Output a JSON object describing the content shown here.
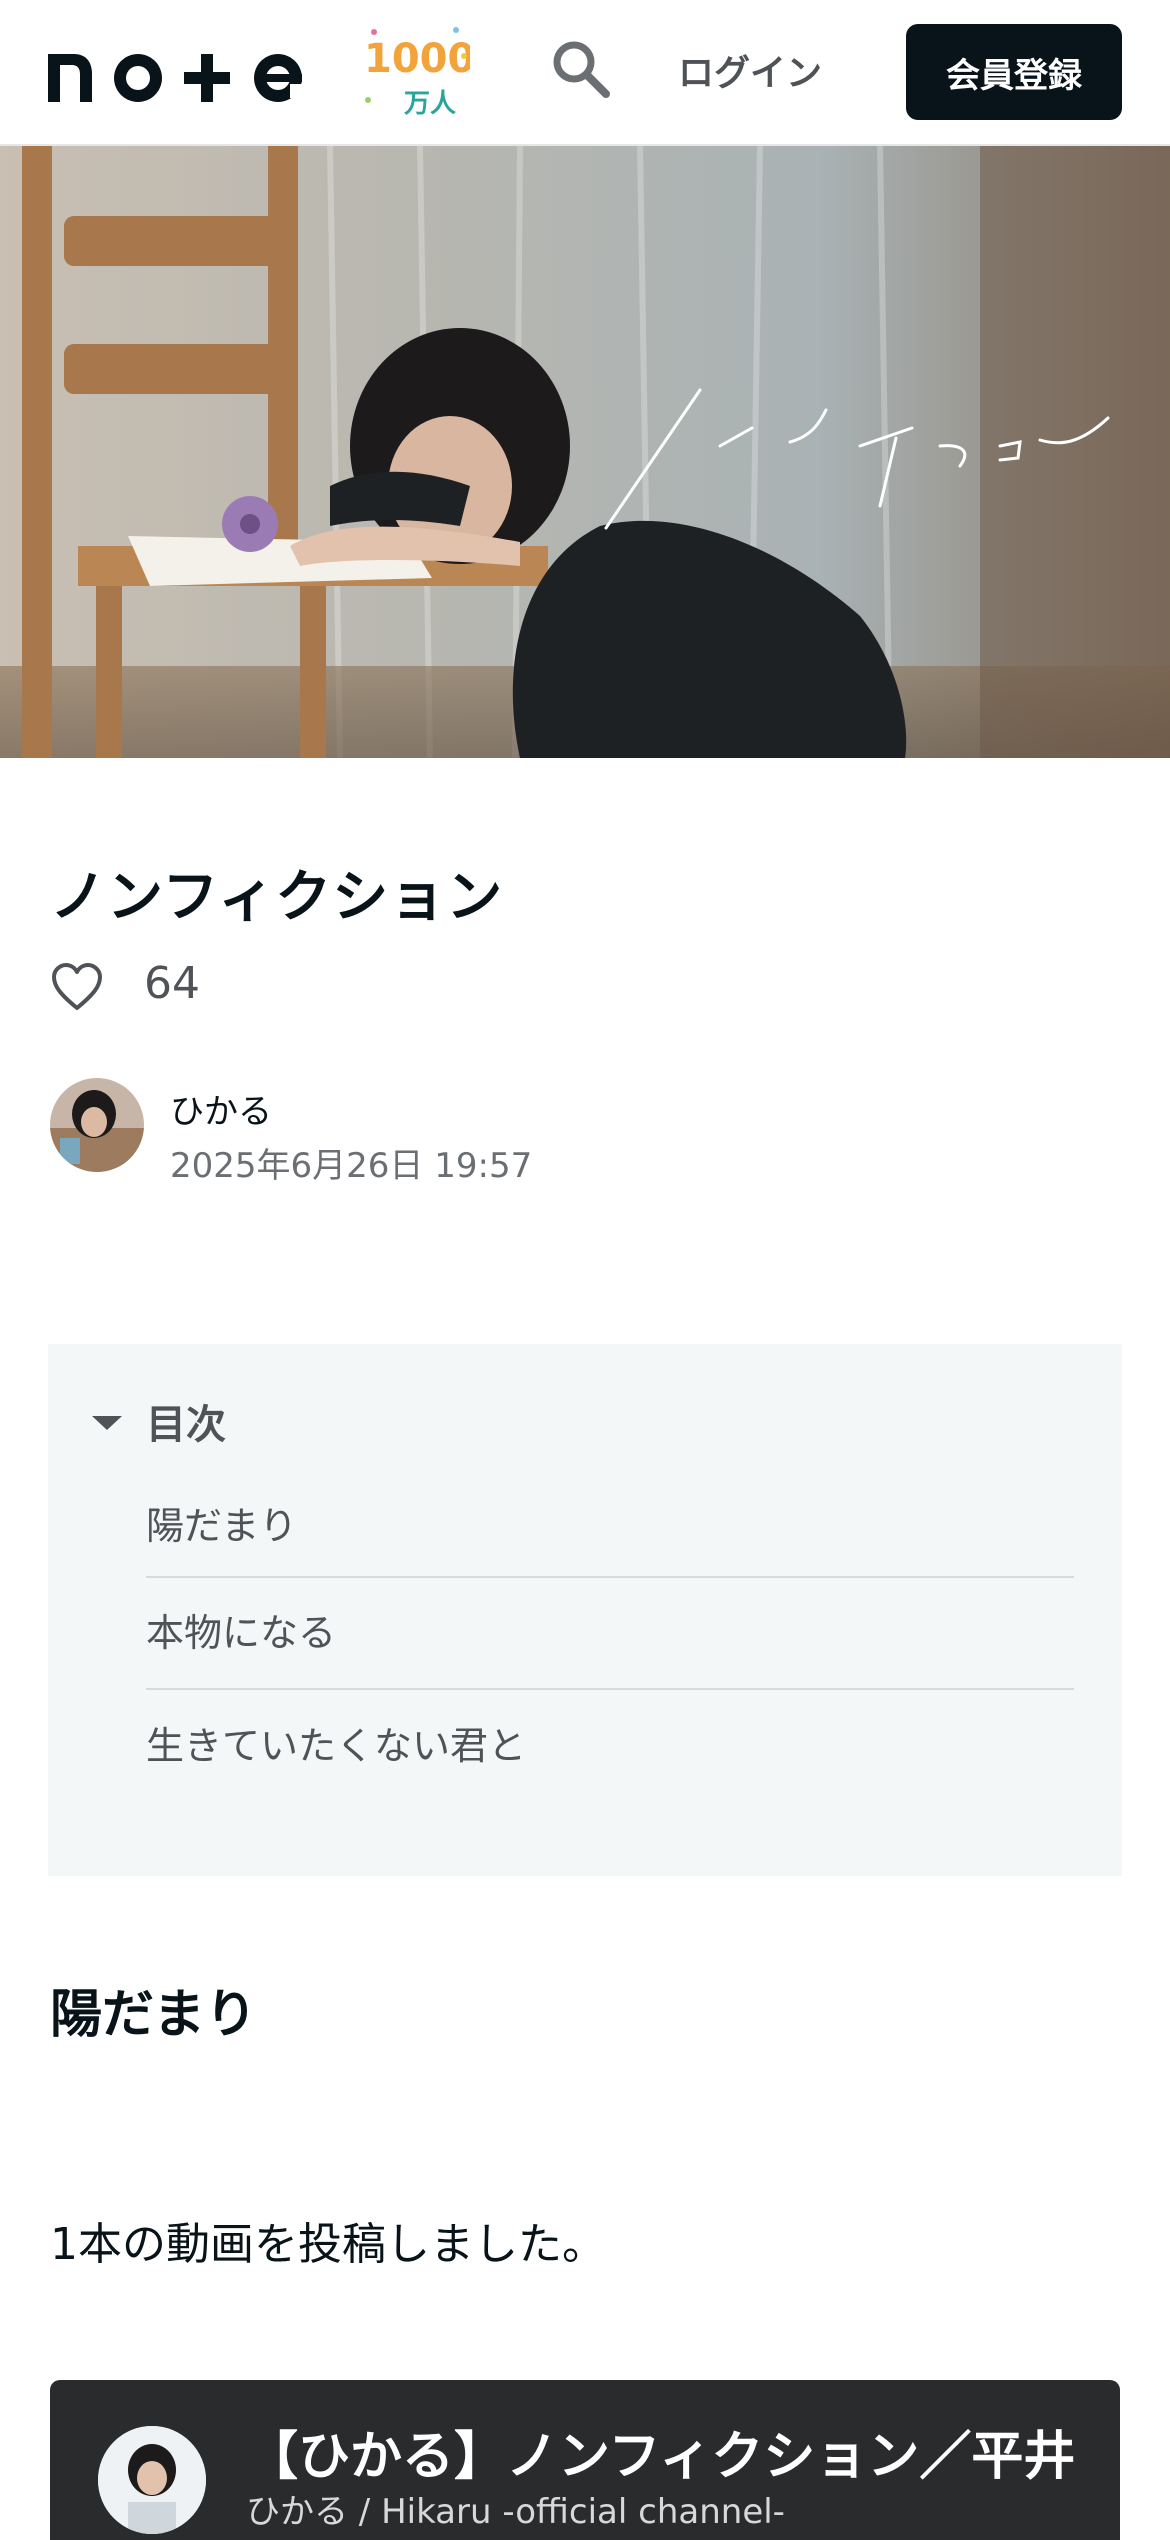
{
  "header": {
    "logo_text": "note",
    "badge_number": "1000",
    "badge_unit": "万人",
    "login_label": "ログイン",
    "signup_label": "会員登録"
  },
  "hero": {
    "overlay_text": "ノンフィクション"
  },
  "article": {
    "title": "ノンフィクション",
    "like_count": "64",
    "author": {
      "name": "ひかる",
      "date": "2025年6月26日 19:57"
    }
  },
  "toc": {
    "heading": "目次",
    "items": [
      {
        "label": "陽だまり"
      },
      {
        "label": "本物になる"
      },
      {
        "label": "生きていたくない君と"
      }
    ]
  },
  "content": {
    "section_heading": "陽だまり",
    "paragraph": "1本の動画を投稿しました。"
  },
  "video": {
    "title": "【ひかる】ノンフィクション／平井",
    "channel": "ひかる / Hikaru -official channel-"
  },
  "colors": {
    "primary_dark": "#08131a",
    "secondary_text": "#4f5256",
    "toc_background": "#f4f7f8"
  },
  "icons": [
    "search-icon",
    "heart-icon",
    "caret-down-icon"
  ]
}
